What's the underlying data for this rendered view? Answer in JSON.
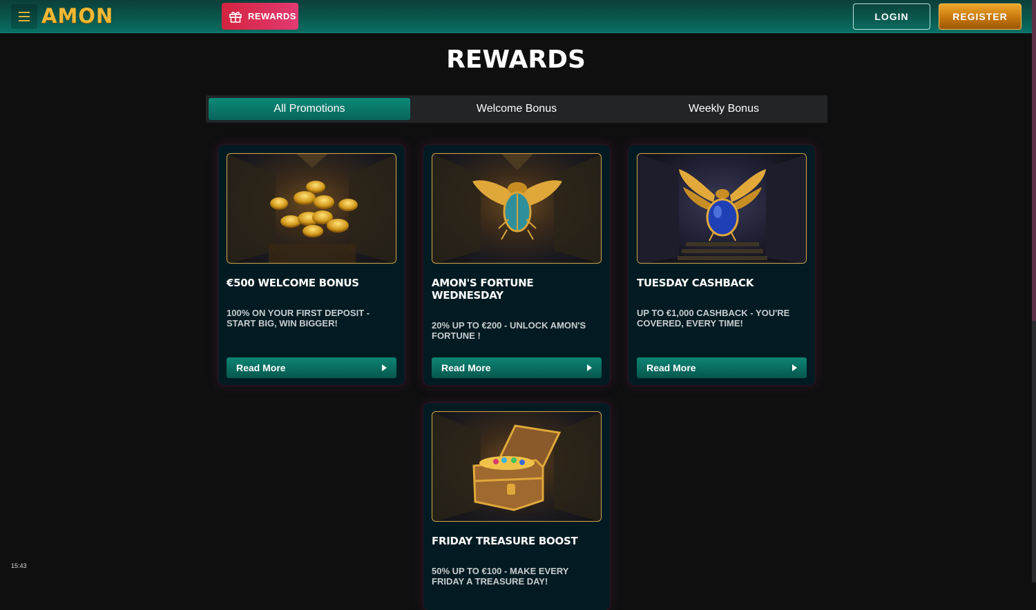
{
  "header": {
    "logo": "AMON",
    "rewards_label": "REWARDS",
    "login_label": "LOGIN",
    "register_label": "REGISTER"
  },
  "main": {
    "title": "REWARDS",
    "tabs": [
      {
        "label": "All Promotions",
        "active": true
      },
      {
        "label": "Welcome Bonus",
        "active": false
      },
      {
        "label": "Weekly Bonus",
        "active": false
      }
    ],
    "cards": [
      {
        "title": "€500 WELCOME BONUS",
        "description": "100% ON YOUR FIRST DEPOSIT - START BIG, WIN BIGGER!",
        "button": "Read More",
        "image": "gold-coins"
      },
      {
        "title": "AMON'S FORTUNE WEDNESDAY",
        "description": "20% UP TO €200 - UNLOCK AMON'S FORTUNE !",
        "button": "Read More",
        "image": "golden-scarab"
      },
      {
        "title": "TUESDAY CASHBACK",
        "description": "UP TO €1,000 CASHBACK - YOU'RE COVERED, EVERY TIME!",
        "button": "Read More",
        "image": "blue-scarab"
      },
      {
        "title": "FRIDAY TREASURE BOOST",
        "description": "50% UP TO €100 - MAKE EVERY FRIDAY A TREASURE DAY!",
        "button": "Read More",
        "image": "treasure-chest"
      }
    ]
  },
  "clock": "15:43",
  "colors": {
    "accent_teal": "#0a5a50",
    "gold": "#f1b733",
    "rewards_pink": "#e23a72",
    "card_bg": "#021b22"
  }
}
